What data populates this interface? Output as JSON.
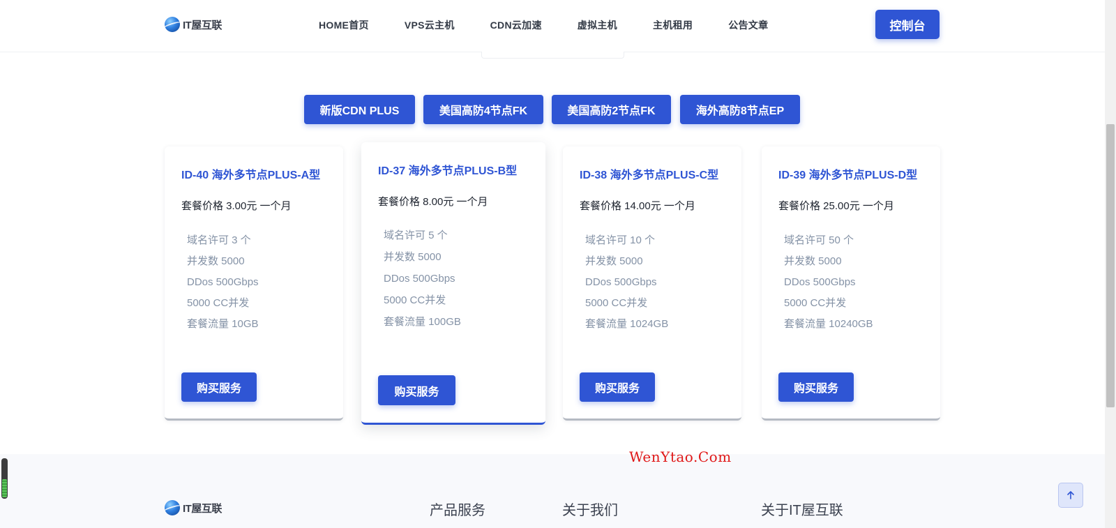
{
  "header": {
    "logo_text": "IT屋互联",
    "nav": [
      "HOME首页",
      "VPS云主机",
      "CDN云加速",
      "虚拟主机",
      "主机租用",
      "公告文章"
    ],
    "console_label": "控制台"
  },
  "tabs": [
    "新版CDN PLUS",
    "美国高防4节点FK",
    "美国高防2节点FK",
    "海外高防8节点EP"
  ],
  "plans": [
    {
      "title": "ID-40 海外多节点PLUS-A型",
      "price": "套餐价格 3.00元 一个月",
      "features": [
        "域名许可 3 个",
        "并发数 5000",
        "DDos 500Gbps",
        "5000 CC并发",
        "套餐流量 10GB"
      ],
      "button": "购买服务"
    },
    {
      "title": "ID-37 海外多节点PLUS-B型",
      "price": "套餐价格 8.00元 一个月",
      "features": [
        "域名许可 5 个",
        "并发数 5000",
        "DDos 500Gbps",
        "5000 CC并发",
        "套餐流量 100GB"
      ],
      "button": "购买服务"
    },
    {
      "title": "ID-38 海外多节点PLUS-C型",
      "price": "套餐价格 14.00元 一个月",
      "features": [
        "域名许可 10 个",
        "并发数 5000",
        "DDos 500Gbps",
        "5000 CC并发",
        "套餐流量 1024GB"
      ],
      "button": "购买服务"
    },
    {
      "title": "ID-39 海外多节点PLUS-D型",
      "price": "套餐价格 25.00元 一个月",
      "features": [
        "域名许可 50 个",
        "并发数 5000",
        "DDos 500Gbps",
        "5000 CC并发",
        "套餐流量 10240GB"
      ],
      "button": "购买服务"
    }
  ],
  "watermark": "WenYtao.Com",
  "footer": {
    "logo_text": "IT屋互联",
    "headings": [
      "产品服务",
      "关于我们",
      "关于IT屋互联"
    ]
  },
  "icons": {
    "back_to_top": "arrow-up-icon",
    "logo": "globe-logo-icon"
  },
  "colors": {
    "accent": "#2f55d4",
    "feature_text": "#8492a6",
    "watermark": "#e01818"
  }
}
